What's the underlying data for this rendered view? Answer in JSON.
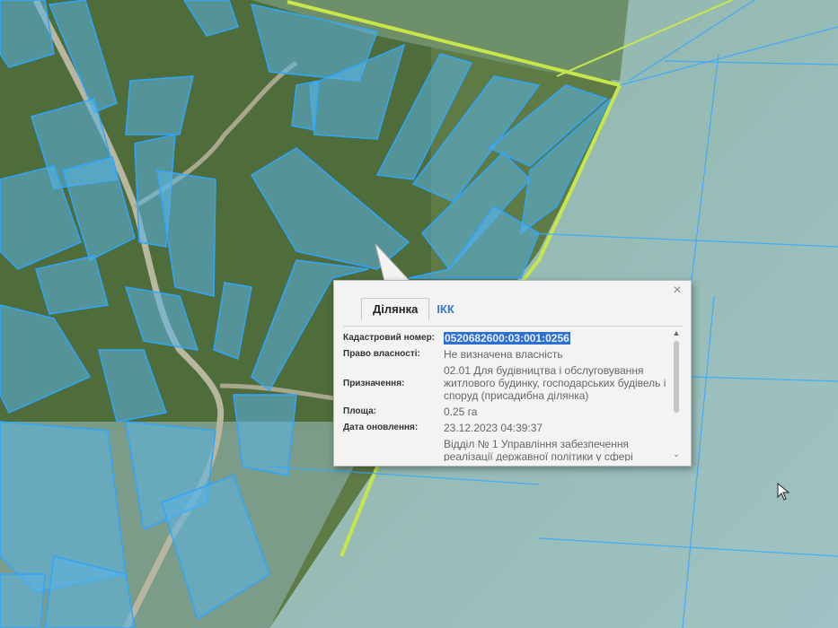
{
  "popup": {
    "tabs": [
      {
        "label": "Ділянка",
        "active": true
      },
      {
        "label": "ІКК",
        "active": false
      }
    ],
    "close_symbol": "×",
    "fields": [
      {
        "label": "Кадастровий номер:",
        "value": "0520682600:03:001:0256",
        "highlighted": true
      },
      {
        "label": "Право власності:",
        "value": "Не визначена власність"
      },
      {
        "label": "Призначення:",
        "value": "02.01 Для будівництва і обслуговування житлового будинку, господарських будівель і споруд (присадибна ділянка)"
      },
      {
        "label": "Площа:",
        "value": "0.25 га"
      },
      {
        "label": "Дата оновлення:",
        "value": "23.12.2023 04:39:37"
      },
      {
        "label": "",
        "value": "Відділ № 1 Управління забезпечення реалізації державної політики у сфері"
      }
    ]
  },
  "colors": {
    "parcel_fill": "#5ab4e6",
    "parcel_stroke": "#2ea6ff",
    "boundary_line": "#c8e64a",
    "tab_link": "#3a78c7",
    "selection": "#2f6fd0"
  },
  "icons": {
    "close": "close-icon",
    "cursor": "mouse-pointer-icon"
  }
}
